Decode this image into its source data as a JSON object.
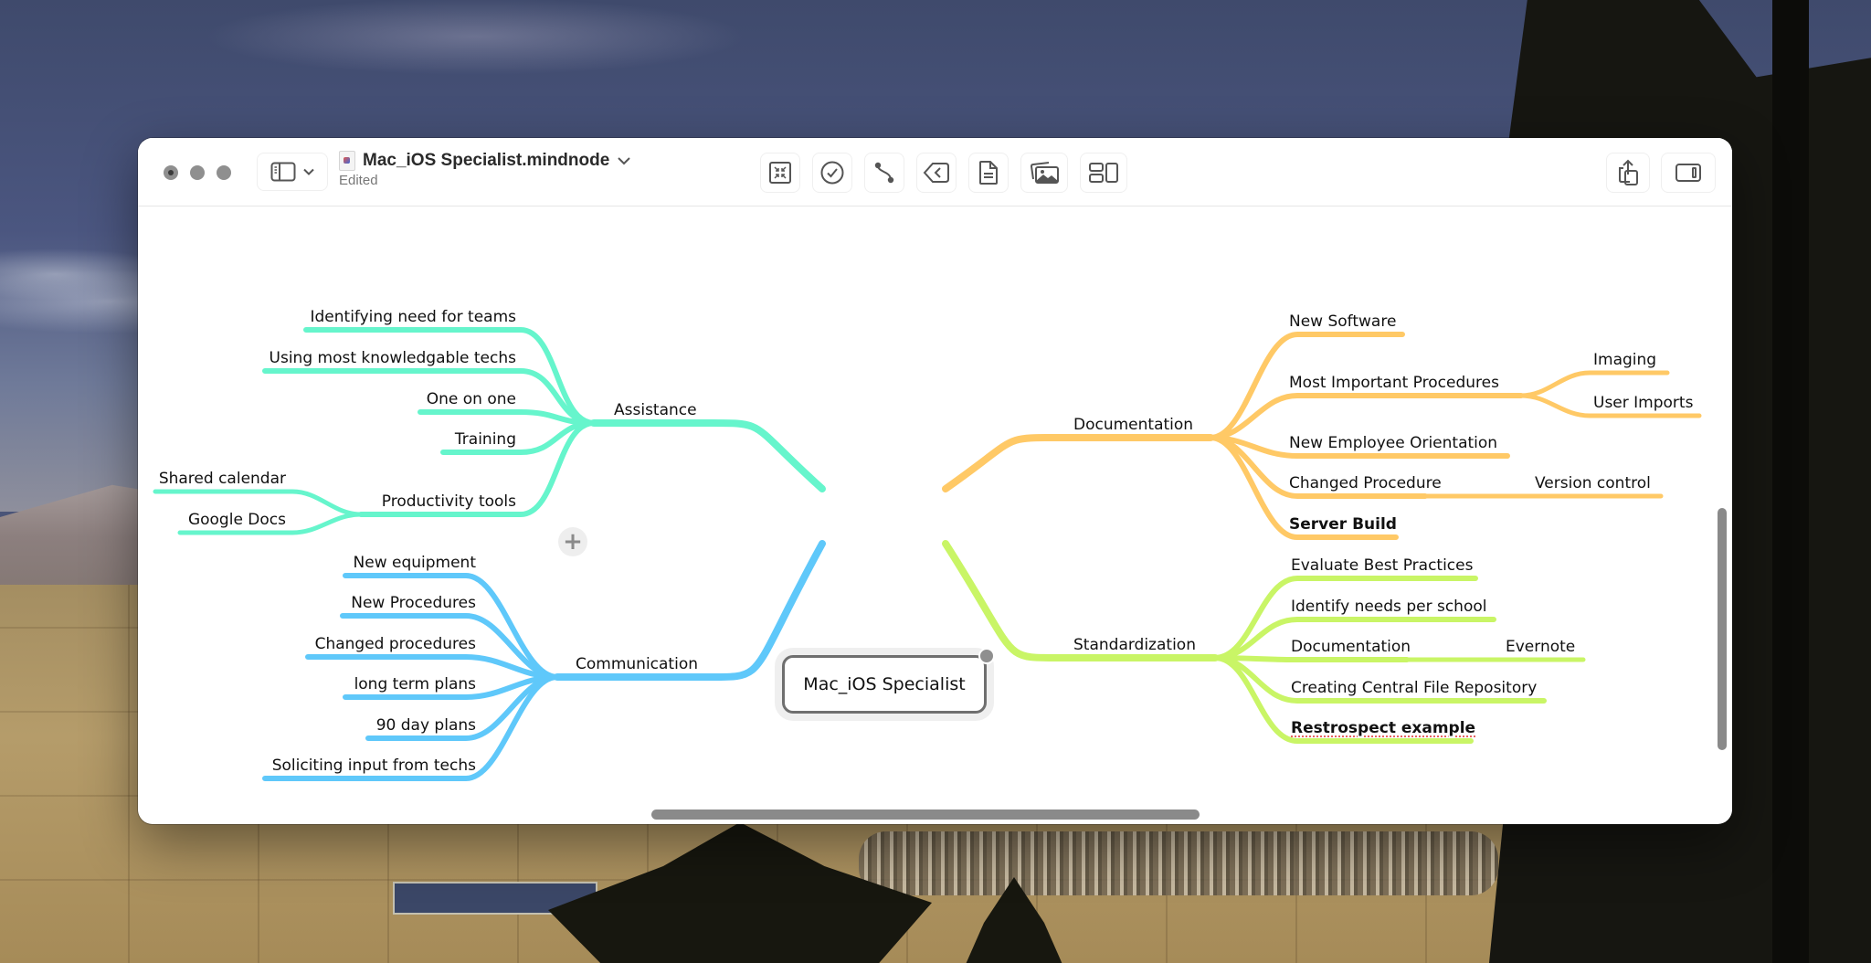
{
  "window": {
    "title": "Mac_iOS Specialist.mindnode",
    "status": "Edited",
    "title_chevron": "⌄"
  },
  "toolbar": {
    "left": [
      {
        "name": "focus-icon",
        "label": "Focus"
      },
      {
        "name": "task-checkmark-icon",
        "label": "Task"
      },
      {
        "name": "connection-icon",
        "label": "Connect"
      },
      {
        "name": "tag-back-icon",
        "label": "Tag"
      },
      {
        "name": "note-document-icon",
        "label": "Note"
      },
      {
        "name": "image-gallery-icon",
        "label": "Image"
      },
      {
        "name": "layout-icon",
        "label": "Layout"
      }
    ],
    "right": [
      {
        "name": "share-icon",
        "label": "Share"
      },
      {
        "name": "inspector-sidebar-icon",
        "label": "Inspector"
      }
    ]
  },
  "colors": {
    "assistance": "#66f5cc",
    "communication": "#5fc8fa",
    "documentation": "#ffc966",
    "standardization": "#c9f566"
  },
  "mindmap": {
    "root": "Mac_iOS Specialist",
    "branches": [
      {
        "label": "Assistance",
        "color_key": "assistance",
        "children": [
          {
            "label": "Identifying need for teams"
          },
          {
            "label": "Using most knowledgable techs"
          },
          {
            "label": "One on one"
          },
          {
            "label": "Training"
          },
          {
            "label": "Productivity tools",
            "children": [
              {
                "label": "Shared calendar"
              },
              {
                "label": "Google Docs"
              }
            ]
          }
        ]
      },
      {
        "label": "Communication",
        "color_key": "communication",
        "children": [
          {
            "label": "New equipment"
          },
          {
            "label": "New Procedures"
          },
          {
            "label": "Changed procedures"
          },
          {
            "label": "long term plans"
          },
          {
            "label": "90 day plans"
          },
          {
            "label": "Soliciting input from techs"
          }
        ]
      },
      {
        "label": "Documentation",
        "color_key": "documentation",
        "children": [
          {
            "label": "New Software"
          },
          {
            "label": "Most Important Procedures",
            "children": [
              {
                "label": "Imaging"
              },
              {
                "label": "User Imports"
              }
            ]
          },
          {
            "label": "New Employee Orientation"
          },
          {
            "label": "Changed Procedure",
            "children": [
              {
                "label": "Version control"
              }
            ]
          },
          {
            "label": "Server Build",
            "bold": true
          }
        ]
      },
      {
        "label": "Standardization",
        "color_key": "standardization",
        "children": [
          {
            "label": "Evaluate Best Practices"
          },
          {
            "label": "Identify needs per school"
          },
          {
            "label": "Documentation",
            "children": [
              {
                "label": "Evernote"
              }
            ]
          },
          {
            "label": "Creating Central File Repository"
          },
          {
            "label": "Restrospect example",
            "bold": true,
            "spellcheck_flag": true
          }
        ]
      }
    ]
  },
  "handles": {
    "add_node": "+"
  }
}
